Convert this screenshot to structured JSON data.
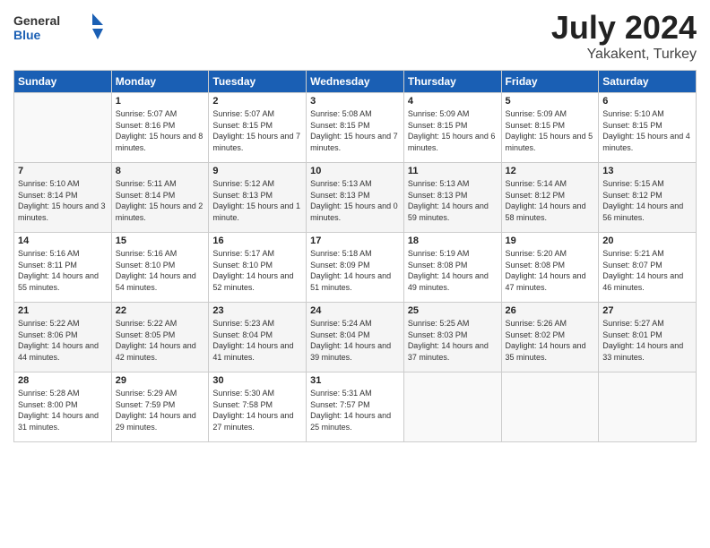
{
  "header": {
    "logo_general": "General",
    "logo_blue": "Blue",
    "title": "July 2024",
    "location": "Yakakent, Turkey"
  },
  "weekdays": [
    "Sunday",
    "Monday",
    "Tuesday",
    "Wednesday",
    "Thursday",
    "Friday",
    "Saturday"
  ],
  "weeks": [
    [
      {
        "day": "",
        "sunrise": "",
        "sunset": "",
        "daylight": ""
      },
      {
        "day": "1",
        "sunrise": "Sunrise: 5:07 AM",
        "sunset": "Sunset: 8:16 PM",
        "daylight": "Daylight: 15 hours and 8 minutes."
      },
      {
        "day": "2",
        "sunrise": "Sunrise: 5:07 AM",
        "sunset": "Sunset: 8:15 PM",
        "daylight": "Daylight: 15 hours and 7 minutes."
      },
      {
        "day": "3",
        "sunrise": "Sunrise: 5:08 AM",
        "sunset": "Sunset: 8:15 PM",
        "daylight": "Daylight: 15 hours and 7 minutes."
      },
      {
        "day": "4",
        "sunrise": "Sunrise: 5:09 AM",
        "sunset": "Sunset: 8:15 PM",
        "daylight": "Daylight: 15 hours and 6 minutes."
      },
      {
        "day": "5",
        "sunrise": "Sunrise: 5:09 AM",
        "sunset": "Sunset: 8:15 PM",
        "daylight": "Daylight: 15 hours and 5 minutes."
      },
      {
        "day": "6",
        "sunrise": "Sunrise: 5:10 AM",
        "sunset": "Sunset: 8:15 PM",
        "daylight": "Daylight: 15 hours and 4 minutes."
      }
    ],
    [
      {
        "day": "7",
        "sunrise": "Sunrise: 5:10 AM",
        "sunset": "Sunset: 8:14 PM",
        "daylight": "Daylight: 15 hours and 3 minutes."
      },
      {
        "day": "8",
        "sunrise": "Sunrise: 5:11 AM",
        "sunset": "Sunset: 8:14 PM",
        "daylight": "Daylight: 15 hours and 2 minutes."
      },
      {
        "day": "9",
        "sunrise": "Sunrise: 5:12 AM",
        "sunset": "Sunset: 8:13 PM",
        "daylight": "Daylight: 15 hours and 1 minute."
      },
      {
        "day": "10",
        "sunrise": "Sunrise: 5:13 AM",
        "sunset": "Sunset: 8:13 PM",
        "daylight": "Daylight: 15 hours and 0 minutes."
      },
      {
        "day": "11",
        "sunrise": "Sunrise: 5:13 AM",
        "sunset": "Sunset: 8:13 PM",
        "daylight": "Daylight: 14 hours and 59 minutes."
      },
      {
        "day": "12",
        "sunrise": "Sunrise: 5:14 AM",
        "sunset": "Sunset: 8:12 PM",
        "daylight": "Daylight: 14 hours and 58 minutes."
      },
      {
        "day": "13",
        "sunrise": "Sunrise: 5:15 AM",
        "sunset": "Sunset: 8:12 PM",
        "daylight": "Daylight: 14 hours and 56 minutes."
      }
    ],
    [
      {
        "day": "14",
        "sunrise": "Sunrise: 5:16 AM",
        "sunset": "Sunset: 8:11 PM",
        "daylight": "Daylight: 14 hours and 55 minutes."
      },
      {
        "day": "15",
        "sunrise": "Sunrise: 5:16 AM",
        "sunset": "Sunset: 8:10 PM",
        "daylight": "Daylight: 14 hours and 54 minutes."
      },
      {
        "day": "16",
        "sunrise": "Sunrise: 5:17 AM",
        "sunset": "Sunset: 8:10 PM",
        "daylight": "Daylight: 14 hours and 52 minutes."
      },
      {
        "day": "17",
        "sunrise": "Sunrise: 5:18 AM",
        "sunset": "Sunset: 8:09 PM",
        "daylight": "Daylight: 14 hours and 51 minutes."
      },
      {
        "day": "18",
        "sunrise": "Sunrise: 5:19 AM",
        "sunset": "Sunset: 8:08 PM",
        "daylight": "Daylight: 14 hours and 49 minutes."
      },
      {
        "day": "19",
        "sunrise": "Sunrise: 5:20 AM",
        "sunset": "Sunset: 8:08 PM",
        "daylight": "Daylight: 14 hours and 47 minutes."
      },
      {
        "day": "20",
        "sunrise": "Sunrise: 5:21 AM",
        "sunset": "Sunset: 8:07 PM",
        "daylight": "Daylight: 14 hours and 46 minutes."
      }
    ],
    [
      {
        "day": "21",
        "sunrise": "Sunrise: 5:22 AM",
        "sunset": "Sunset: 8:06 PM",
        "daylight": "Daylight: 14 hours and 44 minutes."
      },
      {
        "day": "22",
        "sunrise": "Sunrise: 5:22 AM",
        "sunset": "Sunset: 8:05 PM",
        "daylight": "Daylight: 14 hours and 42 minutes."
      },
      {
        "day": "23",
        "sunrise": "Sunrise: 5:23 AM",
        "sunset": "Sunset: 8:04 PM",
        "daylight": "Daylight: 14 hours and 41 minutes."
      },
      {
        "day": "24",
        "sunrise": "Sunrise: 5:24 AM",
        "sunset": "Sunset: 8:04 PM",
        "daylight": "Daylight: 14 hours and 39 minutes."
      },
      {
        "day": "25",
        "sunrise": "Sunrise: 5:25 AM",
        "sunset": "Sunset: 8:03 PM",
        "daylight": "Daylight: 14 hours and 37 minutes."
      },
      {
        "day": "26",
        "sunrise": "Sunrise: 5:26 AM",
        "sunset": "Sunset: 8:02 PM",
        "daylight": "Daylight: 14 hours and 35 minutes."
      },
      {
        "day": "27",
        "sunrise": "Sunrise: 5:27 AM",
        "sunset": "Sunset: 8:01 PM",
        "daylight": "Daylight: 14 hours and 33 minutes."
      }
    ],
    [
      {
        "day": "28",
        "sunrise": "Sunrise: 5:28 AM",
        "sunset": "Sunset: 8:00 PM",
        "daylight": "Daylight: 14 hours and 31 minutes."
      },
      {
        "day": "29",
        "sunrise": "Sunrise: 5:29 AM",
        "sunset": "Sunset: 7:59 PM",
        "daylight": "Daylight: 14 hours and 29 minutes."
      },
      {
        "day": "30",
        "sunrise": "Sunrise: 5:30 AM",
        "sunset": "Sunset: 7:58 PM",
        "daylight": "Daylight: 14 hours and 27 minutes."
      },
      {
        "day": "31",
        "sunrise": "Sunrise: 5:31 AM",
        "sunset": "Sunset: 7:57 PM",
        "daylight": "Daylight: 14 hours and 25 minutes."
      },
      {
        "day": "",
        "sunrise": "",
        "sunset": "",
        "daylight": ""
      },
      {
        "day": "",
        "sunrise": "",
        "sunset": "",
        "daylight": ""
      },
      {
        "day": "",
        "sunrise": "",
        "sunset": "",
        "daylight": ""
      }
    ]
  ]
}
